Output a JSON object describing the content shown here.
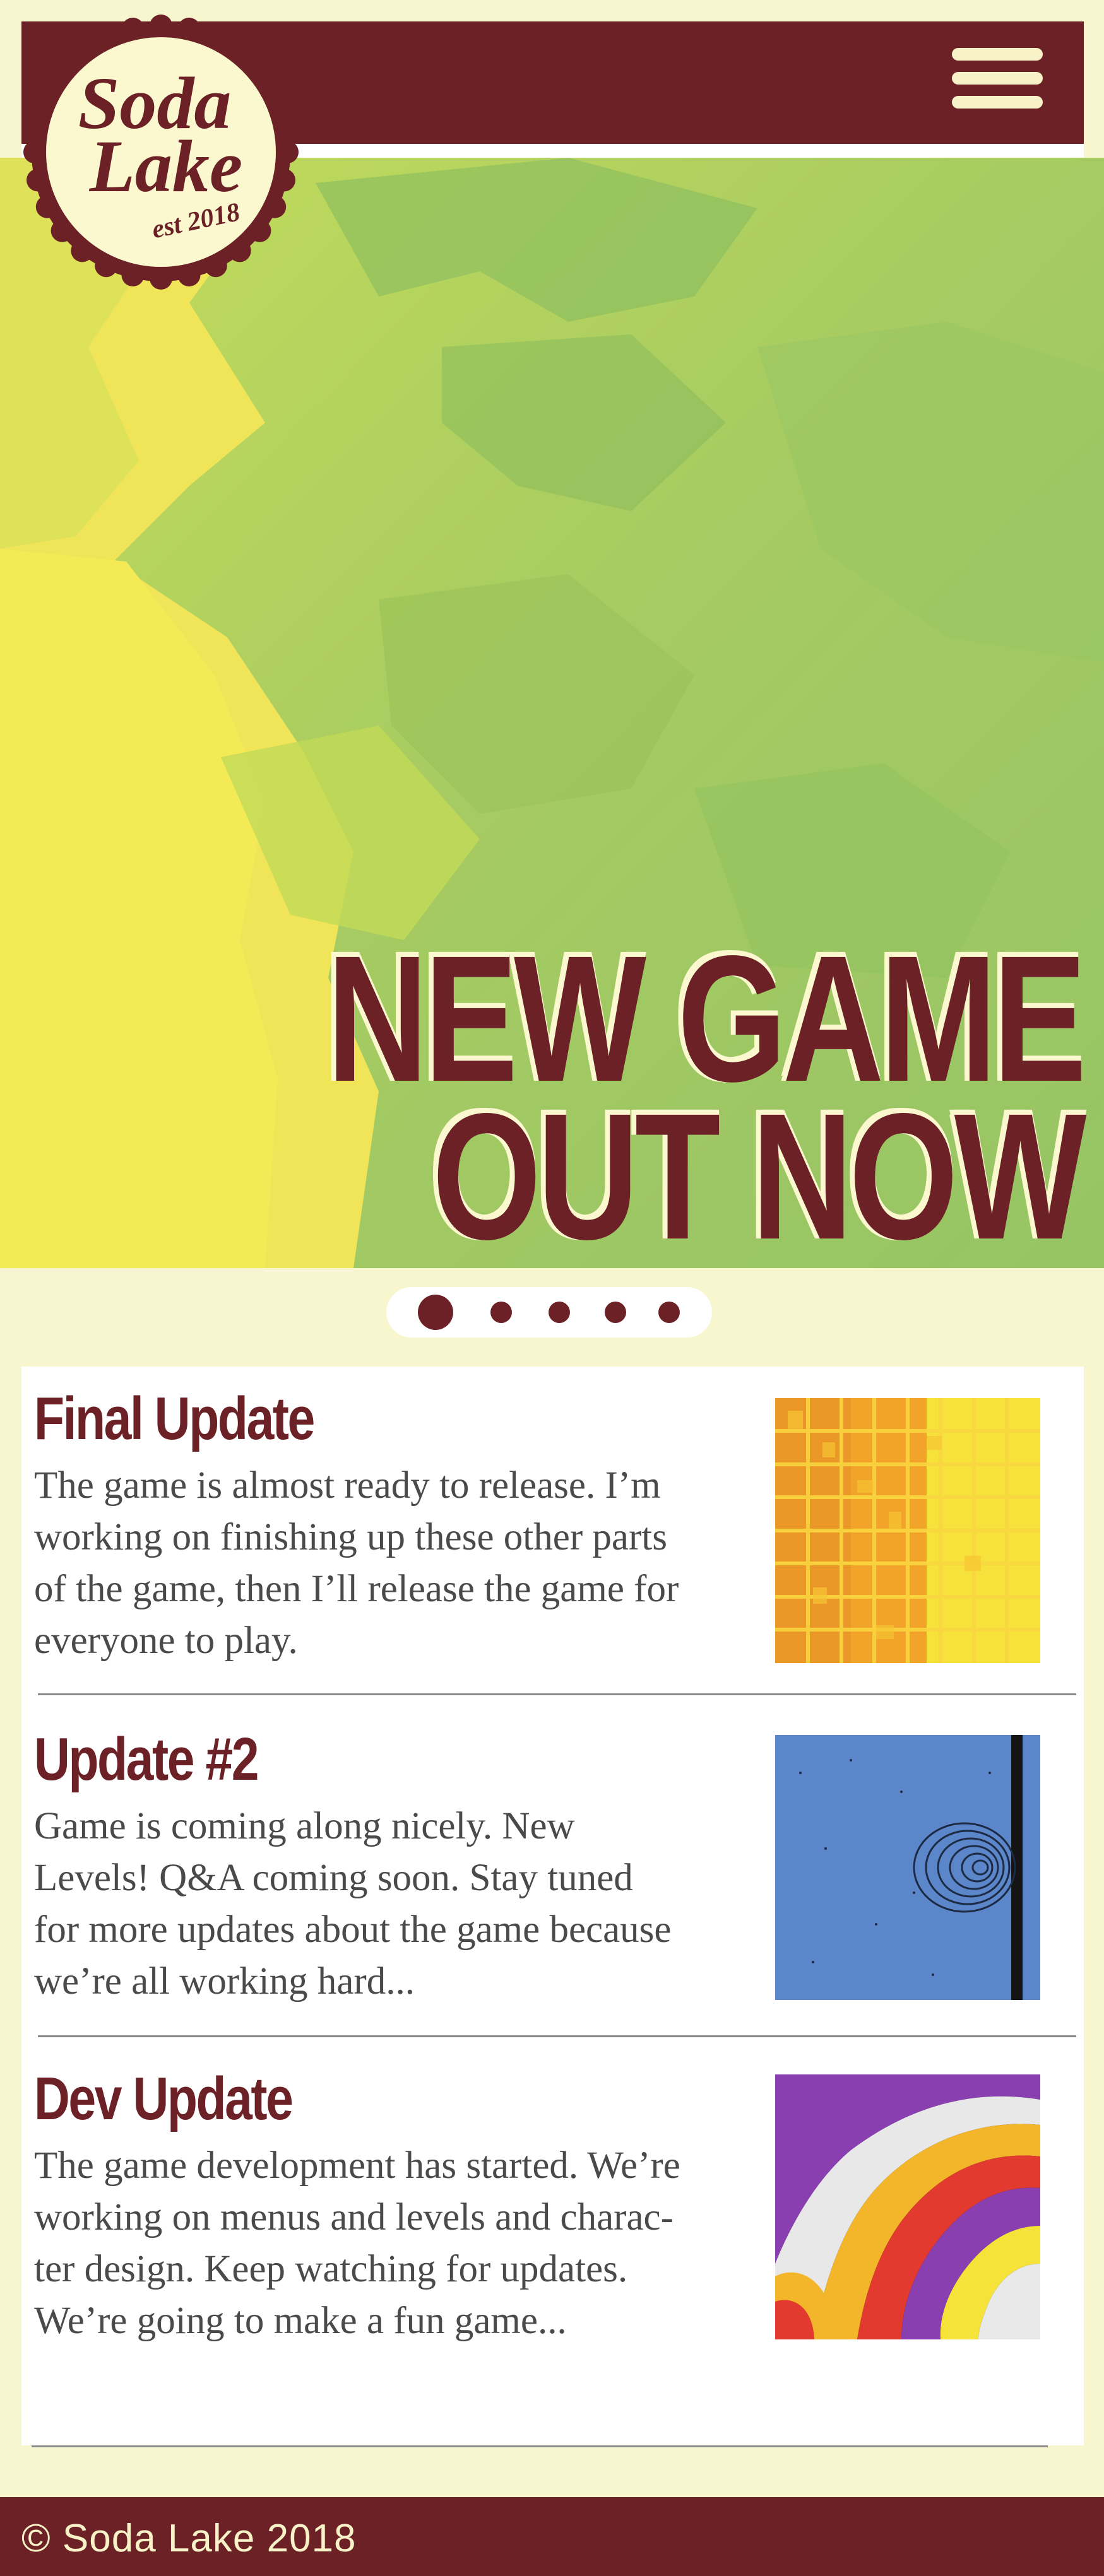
{
  "brand": {
    "logo_line1": "Soda",
    "logo_line2": "Lake",
    "logo_est": "est 2018"
  },
  "header": {
    "menu_icon": "hamburger-menu-icon"
  },
  "hero": {
    "headline_line1": "NEW GAME",
    "headline_line2": "OUT NOW"
  },
  "carousel": {
    "slide_count": 5,
    "active_index": 0
  },
  "posts": [
    {
      "title": "Final Update",
      "body_lines": [
        "The game is almost ready to release. I’m",
        "working on finishing up these other parts",
        "of the game, then I’ll release the game for",
        "everyone to play."
      ],
      "thumbnail": "yellow-orange-grid-thumbnail"
    },
    {
      "title": "Update #2",
      "body_lines": [
        "Game is coming along nicely. New",
        "Levels! Q&A coming soon. Stay tuned",
        "for more updates about the game because",
        "we’re all working hard..."
      ],
      "thumbnail": "blue-ripple-thumbnail"
    },
    {
      "title": "Dev Update",
      "body_lines": [
        "The game development has started. We’re",
        "working on menus and levels and charac-",
        "ter design. Keep watching for updates.",
        "We’re going to make a fun game..."
      ],
      "thumbnail": "colorful-waves-thumbnail"
    }
  ],
  "footer": {
    "copyright": "© Soda Lake 2018"
  },
  "colors": {
    "maroon": "#6b2126",
    "cream": "#f8f6cf",
    "hero_green": "#a0c867",
    "hero_yellow": "#f3ea57"
  }
}
